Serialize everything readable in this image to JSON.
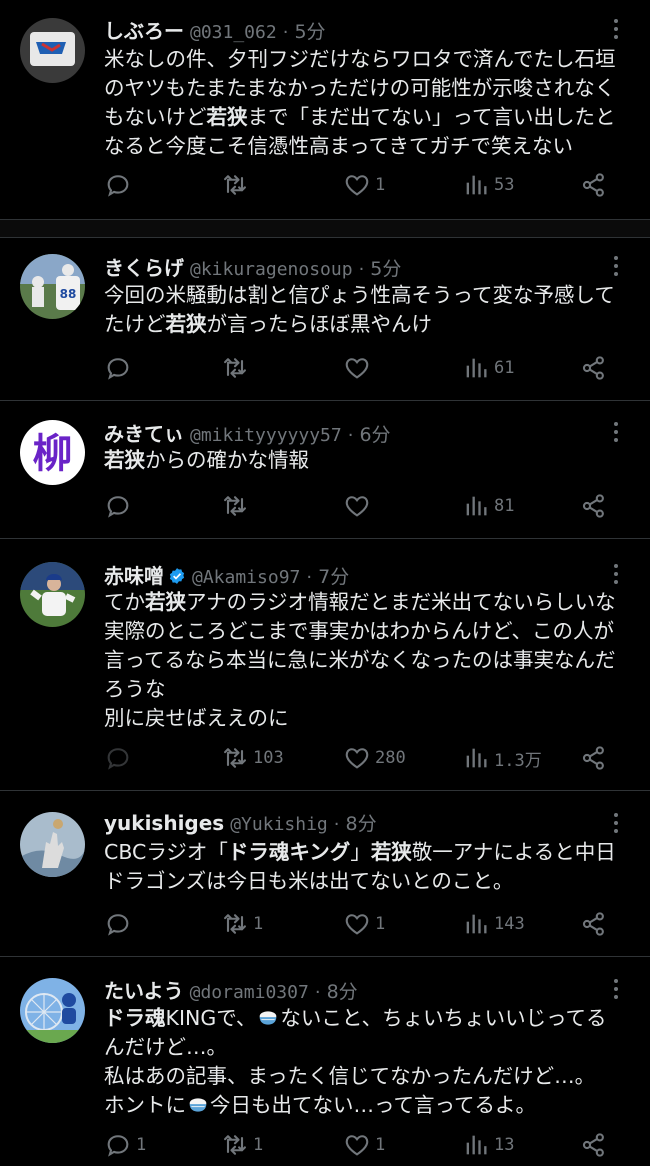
{
  "tweets": [
    {
      "name": "しぶろー",
      "handle": "@031_062",
      "time": "5分",
      "lines": [
        "米なしの件、夕刊フジだけならワロタで済んでたし石垣",
        "のヤツもたまたまなかっただけの可能性が示唆されなく",
        "もないけど<b>若狭</b>まで「まだ出てない」って言い出したと",
        "なると今度こそ信憑性高まってきてガチで笑えない"
      ],
      "reply": "",
      "retweet": "",
      "like": "1",
      "views": "53"
    },
    {
      "name": "きくらげ",
      "handle": "@kikuragenosoup",
      "time": "5分",
      "lines": [
        "今回の米騒動は割と信ぴょう性高そうって変な予感して",
        "たけど<b>若狭</b>が言ったらほぼ黒やんけ"
      ],
      "reply": "",
      "retweet": "",
      "like": "",
      "views": "61"
    },
    {
      "name": "みきてぃ",
      "handle": "@mikityyyyyy57",
      "time": "6分",
      "lines": [
        "<b>若狭</b>からの確かな情報"
      ],
      "reply": "",
      "retweet": "",
      "like": "",
      "views": "81"
    },
    {
      "name": "赤味噌",
      "handle": "@Akamiso97",
      "time": "7分",
      "lines": [
        "てか<b>若狭</b>アナのラジオ情報だとまだ米出てないらしいな",
        "実際のところどこまで事実かはわからんけど、この人が",
        "言ってるなら本当に急に米がなくなったのは事実なんだ",
        "ろうな",
        "別に戻せばええのに"
      ],
      "reply": "",
      "retweet": "103",
      "like": "280",
      "views": "1.3万"
    },
    {
      "name": "yukishiges",
      "handle": "@Yukishig",
      "time": "8分",
      "lines": [
        "CBCラジオ「<b>ドラ魂キング</b>」<b>若狭</b>敬一アナによると中日",
        "ドラゴンズは今日も米は出てないとのこと。"
      ],
      "reply": "",
      "retweet": "1",
      "like": "1",
      "views": "143"
    },
    {
      "name": "たいよう",
      "handle": "@dorami0307",
      "time": "8分",
      "lines": [
        "<b>ドラ魂</b>KINGで、[rice]ないこと、ちょいちょいいじってる",
        "んだけど…。",
        "私はあの記事、まったく信じてなかったんだけど…。",
        "ホントに[rice]今日も出てない…って言ってるよ。"
      ],
      "reply": "1",
      "retweet": "1",
      "like": "1",
      "views": "13"
    }
  ],
  "avatars": {
    "0": {
      "text": ""
    },
    "1": {
      "text": "88"
    },
    "2": {
      "text": "柳"
    },
    "3": {
      "text": ""
    },
    "4": {
      "text": ""
    },
    "5": {
      "text": ""
    }
  },
  "colors": {
    "background": "#000000",
    "text": "#e7e9ea",
    "muted": "#71767b",
    "verified": "#1d9bf0",
    "separator": "#2f3336"
  },
  "icons": [
    "reply-icon",
    "retweet-icon",
    "like-icon",
    "views-icon",
    "share-icon",
    "more-icon",
    "verified-badge-icon",
    "rice-bowl-emoji"
  ]
}
